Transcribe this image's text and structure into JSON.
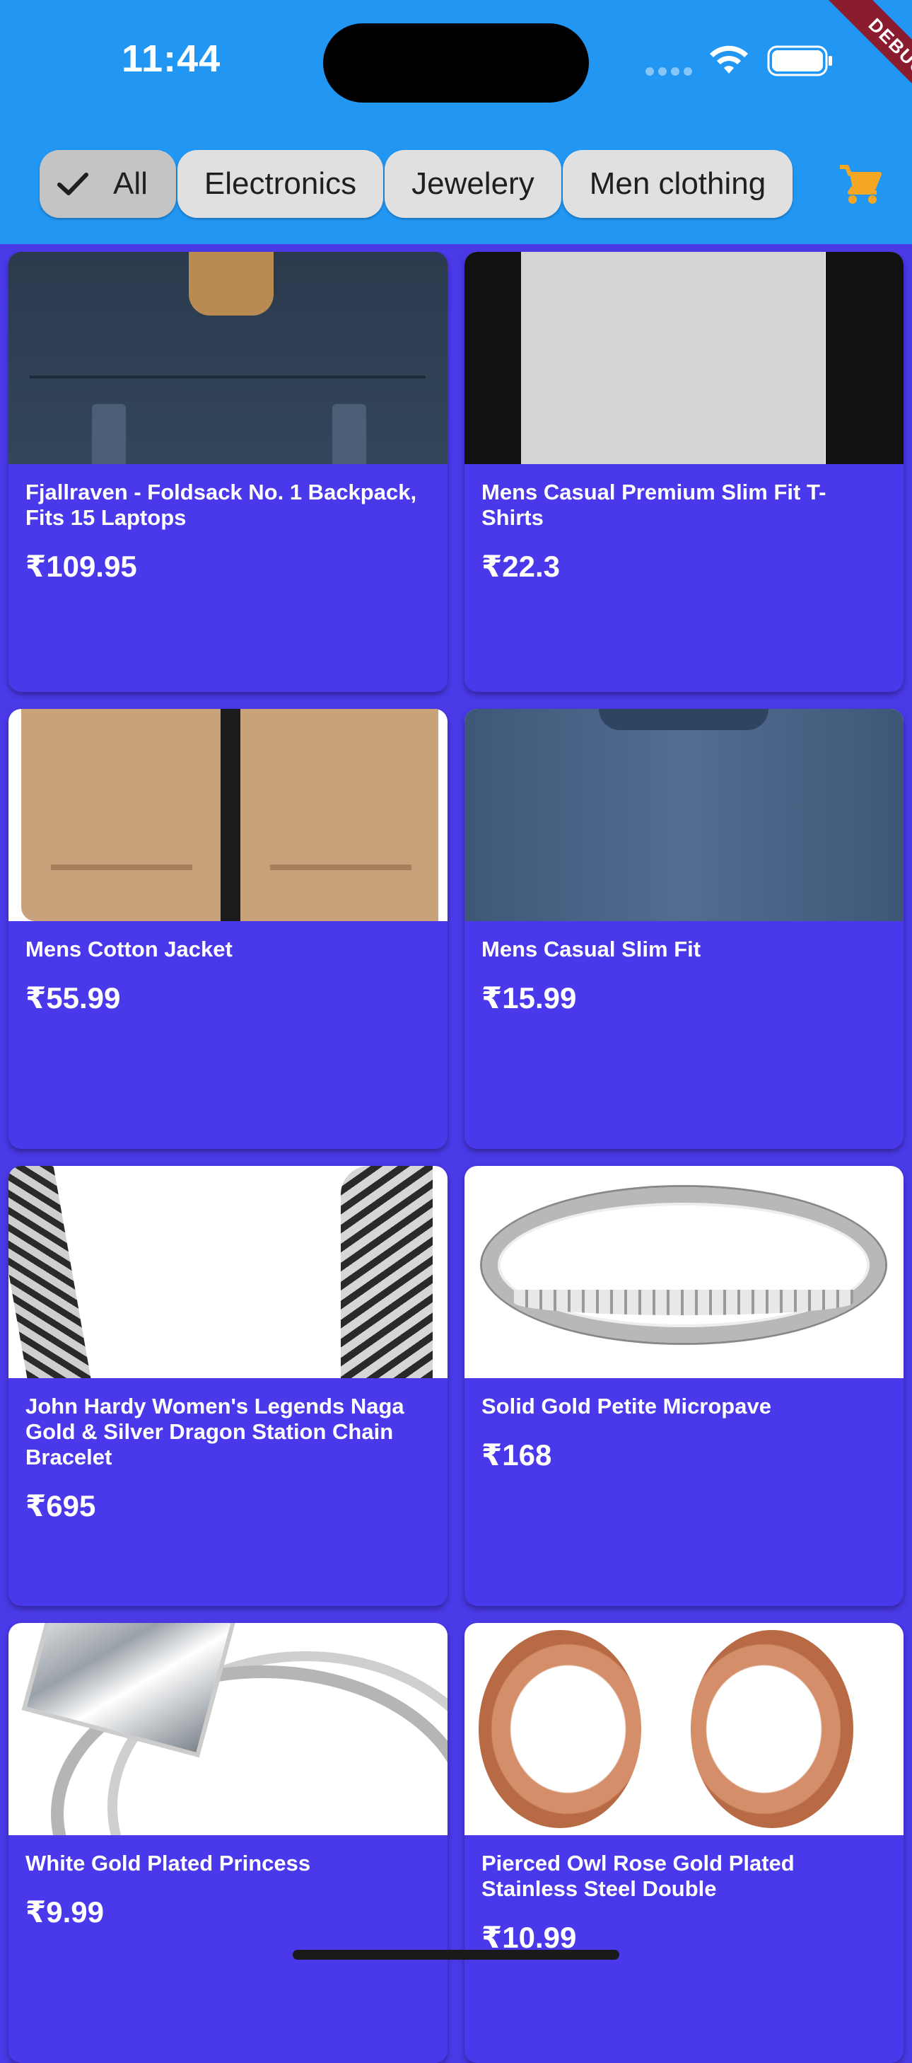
{
  "status_bar": {
    "time": "11:44",
    "debug_label": "DEBUG"
  },
  "filters": {
    "chips": [
      {
        "label": "All",
        "selected": true
      },
      {
        "label": "Electronics",
        "selected": false
      },
      {
        "label": "Jewelery",
        "selected": false
      },
      {
        "label": "Men clothing",
        "selected": false
      }
    ],
    "cart_icon": "shopping-cart-icon",
    "accent_color": "#f5a623"
  },
  "colors": {
    "app_bar": "#2196f3",
    "card_background": "#4a38eb",
    "chip_background": "#e0e0e0",
    "chip_selected_background": "#c4c4c4"
  },
  "products": [
    {
      "title": "Fjallraven - Foldsack No. 1 Backpack, Fits 15 Laptops",
      "price": "₹109.95"
    },
    {
      "title": "Mens Casual Premium Slim Fit T-Shirts",
      "price": "₹22.3"
    },
    {
      "title": "Mens Cotton Jacket",
      "price": "₹55.99"
    },
    {
      "title": "Mens Casual Slim Fit",
      "price": "₹15.99"
    },
    {
      "title": "John Hardy Women's Legends Naga Gold & Silver Dragon Station Chain Bracelet",
      "price": "₹695"
    },
    {
      "title": "Solid Gold Petite Micropave",
      "price": "₹168"
    },
    {
      "title": "White Gold Plated Princess",
      "price": "₹9.99"
    },
    {
      "title": "Pierced Owl Rose Gold Plated Stainless Steel Double",
      "price": "₹10.99"
    }
  ]
}
